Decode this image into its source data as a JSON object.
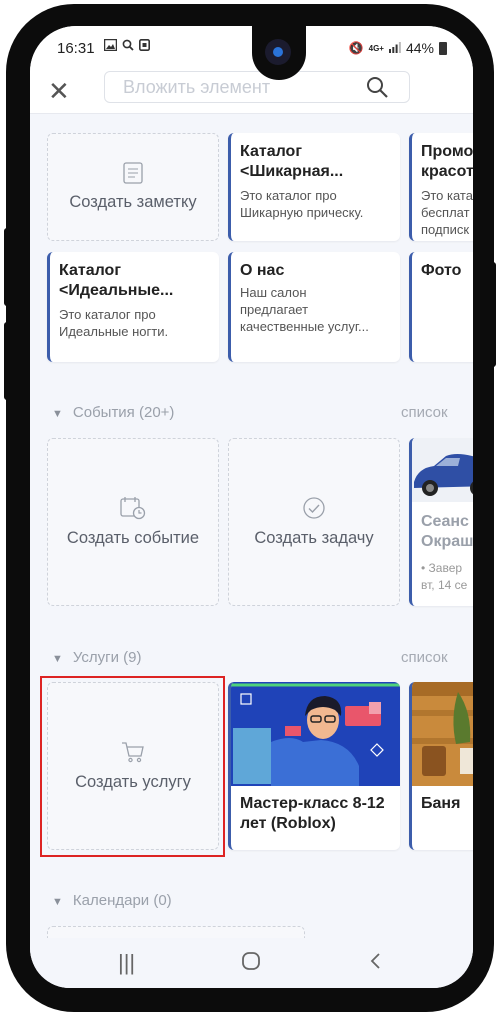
{
  "status_bar": {
    "time": "16:31",
    "network": "4G+",
    "battery": "44%"
  },
  "toolbar": {
    "close_glyph": "✕",
    "search_placeholder": "Вложить элемент"
  },
  "notes": {
    "create_label": "Создать заметку",
    "items": [
      {
        "title": "Каталог",
        "title2": "<Шикарная...",
        "desc": [
          "Это каталог про",
          "Шикарную прическу."
        ]
      },
      {
        "title": "Промо",
        "title2": "красот",
        "desc": [
          "Это ката",
          "бесплат",
          "подписк"
        ]
      },
      {
        "title": "Каталог",
        "title2": "<Идеальные...",
        "desc": [
          "Это каталог про",
          "Идеальные ногти."
        ]
      },
      {
        "title": "О нас",
        "title2": "",
        "desc": [
          "Наш салон",
          "предлагает",
          "качественные услуг..."
        ]
      },
      {
        "title": "Фото",
        "title2": "",
        "desc": []
      }
    ]
  },
  "events": {
    "header": "События (20+)",
    "list_link": "список",
    "create_event_label": "Создать событие",
    "create_task_label": "Создать задачу",
    "item": {
      "title": "Сеанс",
      "title2": "Окраш",
      "meta1": "• Завер",
      "meta2": "вт, 14 се"
    }
  },
  "services": {
    "header": "Услуги (9)",
    "list_link": "список",
    "create_label": "Создать услугу",
    "items": [
      {
        "title": "Мастер-класс 8-12",
        "title2": "лет (Roblox)"
      },
      {
        "title": "Баня",
        "title2": ""
      }
    ]
  },
  "calendars": {
    "header": "Календари (0)"
  },
  "colors": {
    "accent": "#3c5dab",
    "highlight": "#dd2323",
    "background": "#f4f6fb"
  }
}
